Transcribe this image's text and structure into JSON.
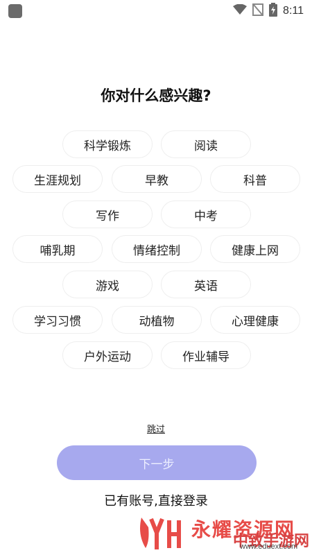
{
  "status_bar": {
    "time": "8:11",
    "icons": [
      "wifi-icon",
      "no-signal-icon",
      "battery-charging-icon"
    ]
  },
  "title": "你对什么感兴趣?",
  "interests": [
    "科学锻炼",
    "阅读",
    "生涯规划",
    "早教",
    "科普",
    "写作",
    "中考",
    "哺乳期",
    "情绪控制",
    "健康上网",
    "游戏",
    "英语",
    "学习习惯",
    "动植物",
    "心理健康",
    "户外运动",
    "作业辅导"
  ],
  "skip_label": "跳过",
  "next_label": "下一步",
  "login_label": "已有账号,直接登录",
  "watermark": {
    "brand": "永耀资源网",
    "brand2": "中致手游网",
    "url": "www.eduext.com"
  },
  "colors": {
    "primary_button": "#a7a9ee",
    "chip_border": "#eeeeee",
    "watermark_red": "#e53935"
  }
}
